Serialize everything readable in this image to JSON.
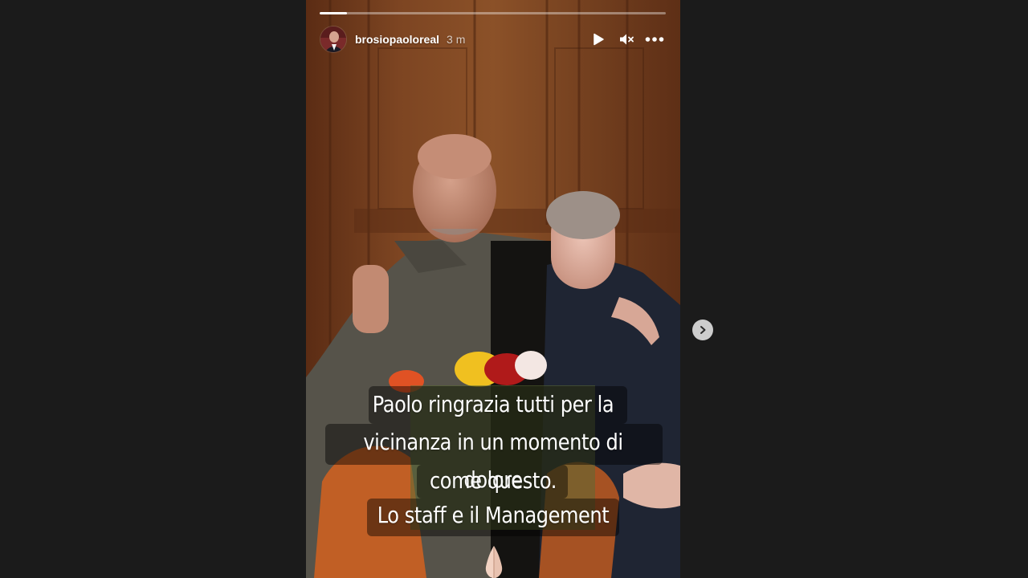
{
  "story": {
    "username": "brosiopaoloreal",
    "timestamp": "3 m",
    "progress": 0.08,
    "caption_lines": [
      "Paolo ringrazia tutti per la",
      "vicinanza in un momento di dolore",
      "come questo."
    ],
    "signature": "Lo staff e il Management",
    "emoji": "folded-hands"
  },
  "controls": {
    "play_icon": "play-icon",
    "mute_icon": "muted-speaker-icon",
    "more_icon": "more-options-icon",
    "next_icon": "chevron-right-icon"
  },
  "colors": {
    "page_background": "#1b1b1b",
    "text": "#ffffff",
    "caption_background": "rgba(0,0,0,0.44)"
  }
}
